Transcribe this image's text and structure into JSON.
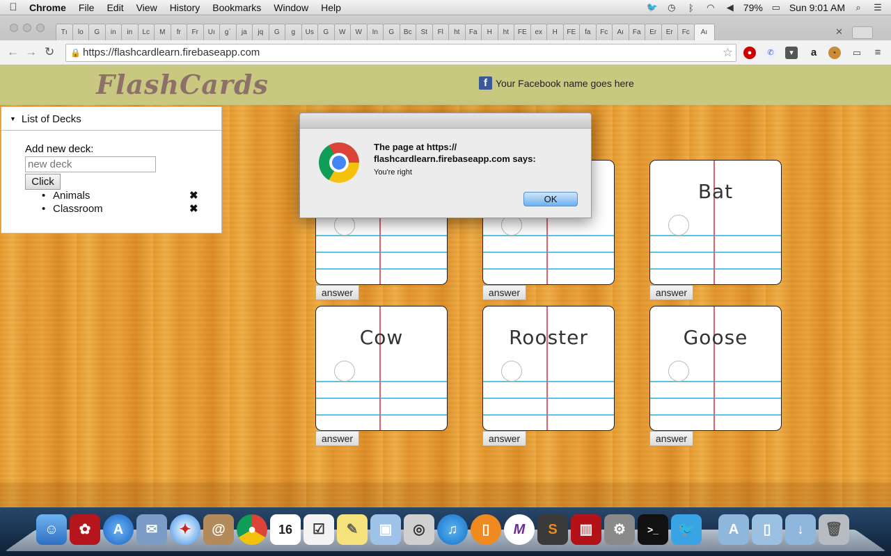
{
  "menubar": {
    "app_name": "Chrome",
    "menus": [
      "File",
      "Edit",
      "View",
      "History",
      "Bookmarks",
      "Window",
      "Help"
    ],
    "battery": "79%",
    "clock": "Sun 9:01 AM"
  },
  "browser": {
    "tab_labels": [
      "Tı",
      "lo",
      "G",
      "in",
      "in",
      "Lc",
      "M",
      "fr",
      "Fr",
      "Uı",
      "gˋ",
      "ja",
      "jq",
      "G",
      "g",
      "Us",
      "G",
      "W",
      "W",
      "In",
      "G",
      "Bc",
      "St",
      "Fl",
      "ht",
      "Fa",
      "H",
      "ht",
      "FE",
      "ex",
      "H",
      "FE",
      "fa",
      "Fc",
      "Aı",
      "Fa",
      "Er",
      "Er",
      "Fc",
      "Aı"
    ],
    "url": "https://flashcardlearn.firebaseapp.com"
  },
  "app": {
    "logo": "FlashCards",
    "facebook_text": "Your Facebook name goes here",
    "deck_panel": {
      "header": "List of Decks",
      "add_label": "Add new deck:",
      "input_placeholder": "new deck",
      "button_label": "Click",
      "decks": [
        "Animals",
        "Classroom"
      ],
      "delete_glyph": "✖"
    },
    "cards": [
      {
        "word": ""
      },
      {
        "word": ""
      },
      {
        "word": "Bat"
      },
      {
        "word": "Cow"
      },
      {
        "word": "Rooster"
      },
      {
        "word": "Goose"
      }
    ],
    "answer_label": "answer"
  },
  "dialog": {
    "title": "The page at https:// flashcardlearn.firebaseapp.com says:",
    "message": "You're right",
    "ok_label": "OK"
  },
  "dock": {
    "apps": [
      "finder",
      "mendeley",
      "app-store",
      "mail-stamp",
      "safari",
      "contacts",
      "chrome",
      "calendar",
      "reminders",
      "stickies",
      "preview",
      "photo-booth",
      "itunes",
      "ibooks",
      "marvel",
      "sublime",
      "photo-booth-curtain",
      "system-preferences",
      "terminal",
      "twitter",
      "applications-folder",
      "documents-folder",
      "downloads-folder",
      "trash"
    ],
    "calendar_day": "16"
  },
  "colors": {
    "header_bg": "#c9c880",
    "logo": "#8d7068",
    "wood": "#e79a2c",
    "card_margin": "#e0626e",
    "card_lines": "#5cc1ea"
  }
}
